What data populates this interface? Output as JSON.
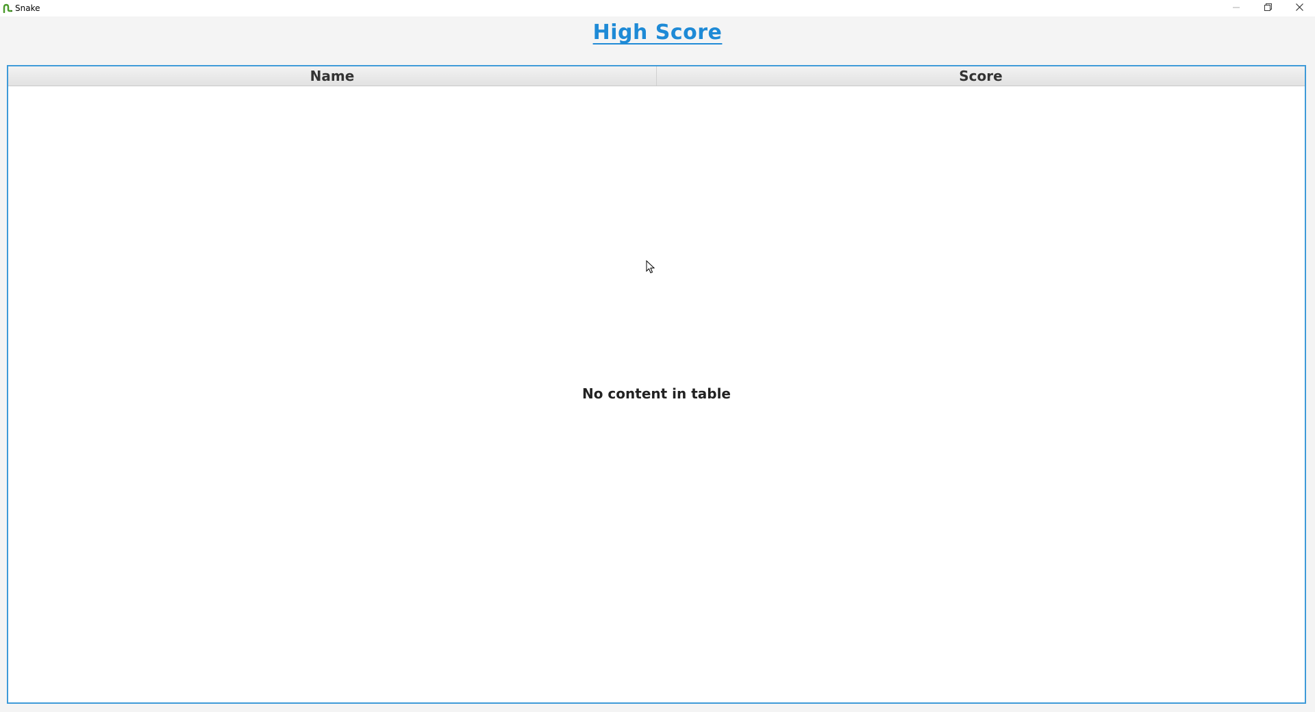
{
  "window": {
    "title": "Snake",
    "icon": "snake-icon",
    "controls": [
      "minimize-icon",
      "restore-icon",
      "close-icon"
    ]
  },
  "heading": "High Score",
  "table": {
    "columns": [
      "Name",
      "Score"
    ],
    "rows": [],
    "empty_text": "No content in table"
  },
  "colors": {
    "accent": "#1e8ad6",
    "table_border": "#3d9ad8",
    "background": "#f4f4f4"
  }
}
